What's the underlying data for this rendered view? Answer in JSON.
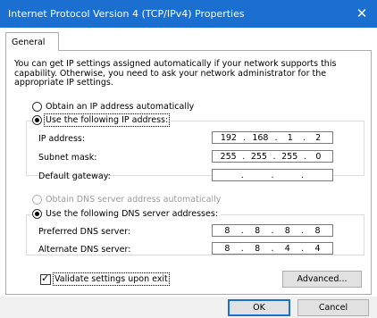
{
  "window": {
    "title": "Internet Protocol Version 4 (TCP/IPv4) Properties",
    "close_glyph": "✕"
  },
  "tabs": [
    {
      "label": "General"
    }
  ],
  "intro_text": "You can get IP settings assigned automatically if your network supports this capability. Otherwise, you need to ask your network administrator for the appropriate IP settings.",
  "ip": {
    "auto_label": "Obtain an IP address automatically",
    "auto_selected": false,
    "manual_label": "Use the following IP address:",
    "manual_selected": true,
    "fields": [
      {
        "label": "IP address:",
        "octets": [
          "192",
          "168",
          "1",
          "2"
        ]
      },
      {
        "label": "Subnet mask:",
        "octets": [
          "255",
          "255",
          "255",
          "0"
        ]
      },
      {
        "label": "Default gateway:",
        "octets": [
          "",
          "",
          "",
          ""
        ]
      }
    ]
  },
  "dns": {
    "auto_label": "Obtain DNS server address automatically",
    "auto_enabled": false,
    "manual_label": "Use the following DNS server addresses:",
    "manual_selected": true,
    "fields": [
      {
        "label": "Preferred DNS server:",
        "octets": [
          "8",
          "8",
          "8",
          "8"
        ]
      },
      {
        "label": "Alternate DNS server:",
        "octets": [
          "8",
          "8",
          "4",
          "4"
        ]
      }
    ]
  },
  "validate": {
    "label": "Validate settings upon exit",
    "checked": true
  },
  "buttons": {
    "advanced": "Advanced...",
    "ok": "OK",
    "cancel": "Cancel"
  },
  "colors": {
    "titlebar": "#1a6fd0",
    "default_button_border": "#1a6fd0"
  }
}
